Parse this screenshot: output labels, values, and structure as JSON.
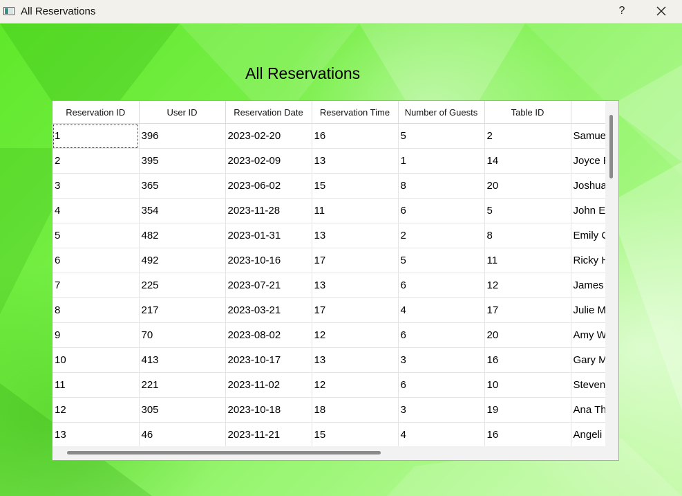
{
  "window": {
    "title": "All Reservations",
    "help_label": "?"
  },
  "heading": "All Reservations",
  "table": {
    "columns": [
      "Reservation ID",
      "User ID",
      "Reservation Date",
      "Reservation Time",
      "Number of Guests",
      "Table ID",
      ""
    ],
    "rows": [
      [
        "1",
        "396",
        "2023-02-20",
        "16",
        "5",
        "2",
        "Samue"
      ],
      [
        "2",
        "395",
        "2023-02-09",
        "13",
        "1",
        "14",
        "Joyce F"
      ],
      [
        "3",
        "365",
        "2023-06-02",
        "15",
        "8",
        "20",
        "Joshua"
      ],
      [
        "4",
        "354",
        "2023-11-28",
        "11",
        "6",
        "5",
        "John Es"
      ],
      [
        "5",
        "482",
        "2023-01-31",
        "13",
        "2",
        "8",
        "Emily C"
      ],
      [
        "6",
        "492",
        "2023-10-16",
        "17",
        "5",
        "11",
        "Ricky H"
      ],
      [
        "7",
        "225",
        "2023-07-21",
        "13",
        "6",
        "12",
        "James"
      ],
      [
        "8",
        "217",
        "2023-03-21",
        "17",
        "4",
        "17",
        "Julie M"
      ],
      [
        "9",
        "70",
        "2023-08-02",
        "12",
        "6",
        "20",
        "Amy W"
      ],
      [
        "10",
        "413",
        "2023-10-17",
        "13",
        "3",
        "16",
        "Gary M"
      ],
      [
        "11",
        "221",
        "2023-11-02",
        "12",
        "6",
        "10",
        "Steven"
      ],
      [
        "12",
        "305",
        "2023-10-18",
        "18",
        "3",
        "19",
        "Ana Th"
      ],
      [
        "13",
        "46",
        "2023-11-21",
        "15",
        "4",
        "16",
        "Angeli"
      ]
    ]
  }
}
